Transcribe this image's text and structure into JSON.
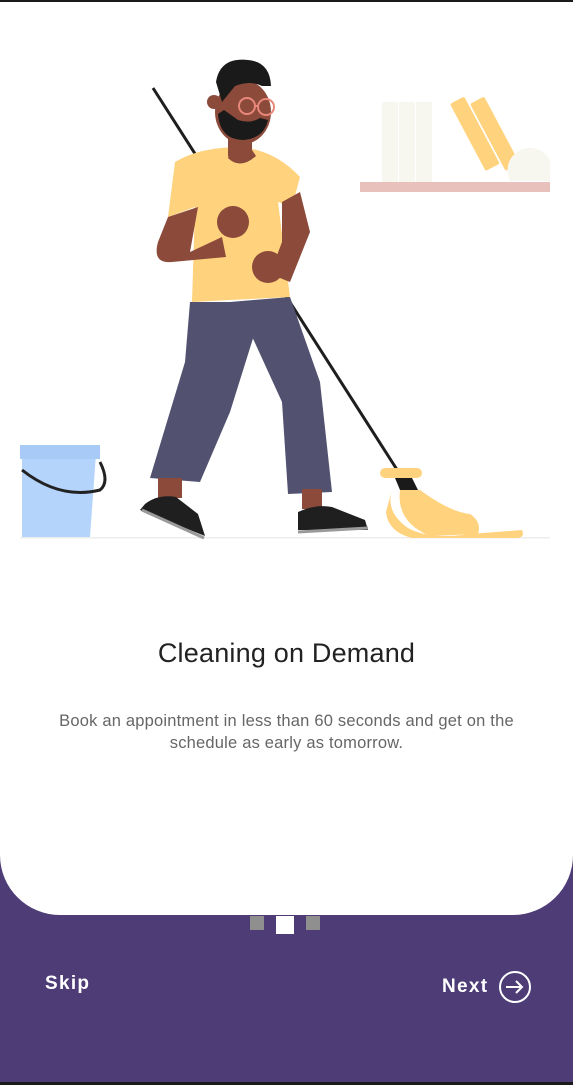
{
  "onboarding": {
    "title": "Cleaning on Demand",
    "subtitle": "Book an appointment in less than 60 seconds and get on the schedule as early as tomorrow.",
    "pager": {
      "total": 3,
      "active_index": 1
    },
    "skip_label": "Skip",
    "next_label": "Next"
  },
  "icons": {
    "next": "arrow-right-circle-icon"
  },
  "colors": {
    "brand_purple": "#4e3c77",
    "card_background": "#ffffff",
    "title_text": "#222222",
    "body_text": "#666666"
  }
}
